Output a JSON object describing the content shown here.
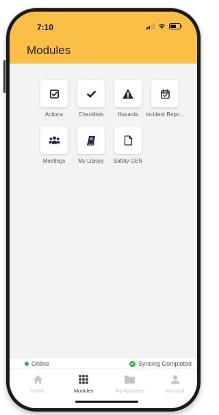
{
  "status_bar": {
    "time": "7:10"
  },
  "header": {
    "title": "Modules",
    "background": "#fbbf47"
  },
  "modules": [
    {
      "label": "Actions",
      "icon": "checkbox-check-icon"
    },
    {
      "label": "Checklists",
      "icon": "checkmark-icon"
    },
    {
      "label": "Hazards",
      "icon": "warning-triangle-icon"
    },
    {
      "label": "Incident Repo...",
      "icon": "calendar-check-icon"
    },
    {
      "label": "Meetings",
      "icon": "people-group-icon"
    },
    {
      "label": "My Library",
      "icon": "book-icon"
    },
    {
      "label": "Safety GEN",
      "icon": "document-icon"
    }
  ],
  "connection": {
    "online_label": "Online",
    "sync_label": "Syncing Completed",
    "status_color": "#2eb24d"
  },
  "tabs": [
    {
      "label": "Home",
      "icon": "home-icon",
      "active": false
    },
    {
      "label": "Modules",
      "icon": "grid-icon",
      "active": true
    },
    {
      "label": "My Activities",
      "icon": "folder-icon",
      "active": false
    },
    {
      "label": "Account",
      "icon": "user-icon",
      "active": false
    }
  ]
}
